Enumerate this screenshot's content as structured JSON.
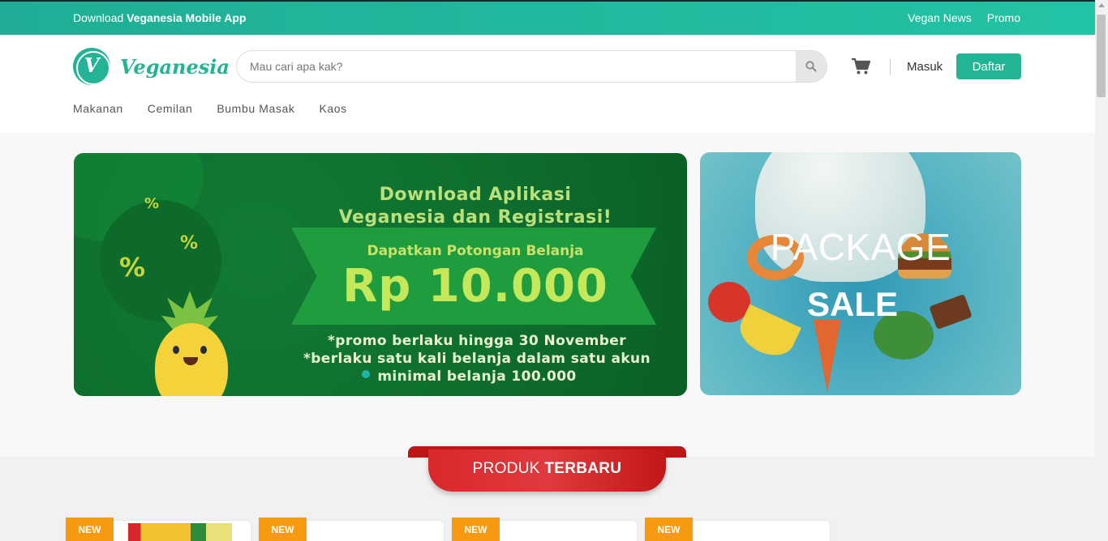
{
  "topbar": {
    "download_prefix": "Download",
    "download_app": "Veganesia Mobile App",
    "links": [
      "Vegan News",
      "Promo"
    ]
  },
  "header": {
    "logo_text": "Veganesia",
    "search_placeholder": "Mau cari apa kak?",
    "login_label": "Masuk",
    "register_label": "Daftar",
    "icons": {
      "search": "search-icon",
      "cart": "cart-icon"
    }
  },
  "categories": [
    "Makanan",
    "Cemilan",
    "Bumbu Masak",
    "Kaos"
  ],
  "banner_main": {
    "title_line1": "Download Aplikasi",
    "title_line2": "Veganesia dan Registrasi!",
    "subtitle": "Dapatkan Potongan Belanja",
    "amount": "Rp 10.000",
    "note1": "*promo berlaku hingga 30 November",
    "note2": "*berlaku satu kali belanja dalam satu akun",
    "note3": "minimal belanja 100.000",
    "pct_symbol": "%"
  },
  "banner_side": {
    "line1": "PACKAGE",
    "line2": "SALE"
  },
  "products_section": {
    "title_prefix": "PRODUK",
    "title_bold": "TERBARU",
    "badge": "NEW",
    "card_count_visible": 4
  },
  "colors": {
    "brand": "#22b495",
    "topbar": "#22c3a4",
    "badge": "#f79a12",
    "ribbon": "#d9282c"
  }
}
